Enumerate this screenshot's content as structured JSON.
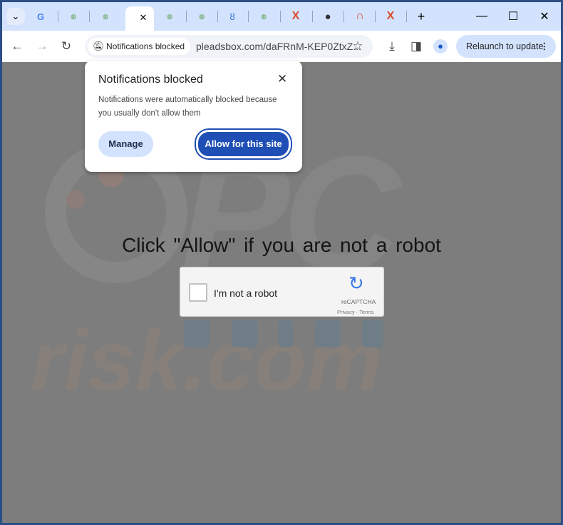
{
  "browser": {
    "tabs": [
      {
        "icon": "google-icon"
      },
      {
        "icon": "vfs-icon"
      },
      {
        "icon": "vfs-icon"
      },
      {
        "icon": "loading-icon",
        "active": true
      },
      {
        "icon": "vfs-icon"
      },
      {
        "icon": "vfs-icon"
      },
      {
        "icon": "ring-icon"
      },
      {
        "icon": "vfs-icon"
      },
      {
        "icon": "x-logo-icon"
      },
      {
        "icon": "globe-icon"
      },
      {
        "icon": "magnet-icon"
      },
      {
        "icon": "x-logo-icon"
      }
    ],
    "chip_label": "Notifications blocked",
    "url": "pleadsbox.com/daFRnM-KEP0ZtxZ...",
    "relaunch_label": "Relaunch to update"
  },
  "popup": {
    "title": "Notifications blocked",
    "body": "Notifications were automatically blocked because you usually don't allow them",
    "manage_label": "Manage",
    "allow_label": "Allow for this site"
  },
  "page": {
    "headline": "Click \"Allow\"   if you are not   a robot",
    "captcha_label": "I'm not a robot",
    "captcha_brand": "reCAPTCHA",
    "captcha_links": "Privacy - Terms",
    "watermark": "PC risk.com"
  },
  "colors": {
    "accent": "#1f4fb5",
    "tabstrip": "#d3e3fd",
    "frame": "#2c4f85"
  }
}
